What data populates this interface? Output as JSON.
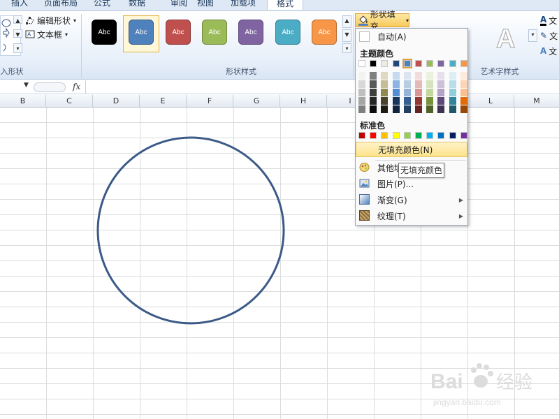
{
  "tabs": [
    "插入",
    "页面布局",
    "公式",
    "数据",
    "审阅",
    "视图",
    "加载项",
    "格式"
  ],
  "ribbon": {
    "insert_group": {
      "edit_shape": "编辑形状",
      "text_box": "文本框",
      "label": "入形状"
    },
    "shape_styles": {
      "label": "形状样式",
      "samples": [
        {
          "text": "Abc",
          "color": "#000000"
        },
        {
          "text": "Abc",
          "color": "#4f81bd"
        },
        {
          "text": "Abc",
          "color": "#c0504d"
        },
        {
          "text": "Abc",
          "color": "#9bbb59"
        },
        {
          "text": "Abc",
          "color": "#8064a2"
        },
        {
          "text": "Abc",
          "color": "#4bacc6"
        },
        {
          "text": "Abc",
          "color": "#f79646"
        }
      ]
    },
    "shape_fill": "形状填充",
    "wordart_label": "艺术字样式",
    "wordart_side": [
      "文",
      "文",
      "文"
    ]
  },
  "columns": [
    "B",
    "C",
    "D",
    "E",
    "F",
    "G",
    "H",
    "I",
    "J",
    "K",
    "L",
    "M"
  ],
  "menu": {
    "auto": "自动(A)",
    "theme_colors_label": "主题颜色",
    "theme_top_row": [
      "#ffffff",
      "#000000",
      "#eeece1",
      "#1f497d",
      "#4f81bd",
      "#c0504d",
      "#9bbb59",
      "#8064a2",
      "#4bacc6",
      "#f79646"
    ],
    "theme_shades": [
      [
        "#f2f2f2",
        "#808080",
        "#ddd9c3",
        "#c6d9f0",
        "#dbe5f1",
        "#f2dcdb",
        "#ebf1dd",
        "#e5e0ec",
        "#dbeef3",
        "#fdeada"
      ],
      [
        "#d8d8d8",
        "#595959",
        "#c4bd97",
        "#8db3e2",
        "#b8cce4",
        "#e5b9b7",
        "#d7e3bc",
        "#ccc1d9",
        "#b7dde8",
        "#fbd5b5"
      ],
      [
        "#bfbfbf",
        "#3f3f3f",
        "#938953",
        "#548dd4",
        "#95b3d7",
        "#d99694",
        "#c3d69b",
        "#b2a2c7",
        "#92cddc",
        "#fac08f"
      ],
      [
        "#a5a5a5",
        "#262626",
        "#494429",
        "#17365d",
        "#366092",
        "#953734",
        "#76923c",
        "#5f497a",
        "#31859b",
        "#e36c09"
      ],
      [
        "#7f7f7f",
        "#0c0c0c",
        "#1d1b10",
        "#0f243e",
        "#244061",
        "#632423",
        "#4f6128",
        "#3f3151",
        "#205867",
        "#974806"
      ]
    ],
    "standard_label": "标准色",
    "standard_colors": [
      "#c00000",
      "#ff0000",
      "#ffc000",
      "#ffff00",
      "#92d050",
      "#00b050",
      "#00b0f0",
      "#0070c0",
      "#002060",
      "#7030a0"
    ],
    "no_fill": "无填充颜色(N)",
    "more_fill": "其他填",
    "picture": "图片(P)...",
    "gradient": "渐变(G)",
    "texture": "纹理(T)",
    "tooltip": "无填充颜色"
  },
  "circle": {
    "stroke": "#3c5a87"
  },
  "watermark": {
    "brand": "Bai",
    "brand_tail": "经验",
    "url": "jingyan.baidu.com"
  }
}
